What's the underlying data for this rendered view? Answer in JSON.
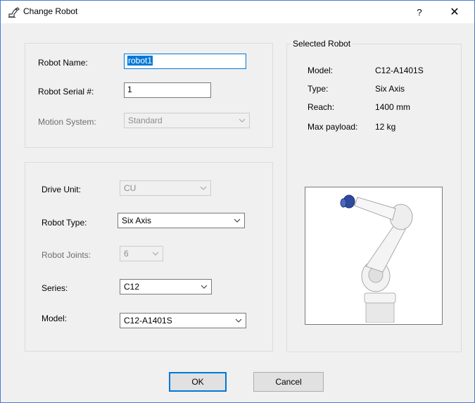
{
  "window": {
    "title": "Change Robot",
    "help_label": "?",
    "close_label": "✕"
  },
  "robot_group": {
    "name_label": "Robot Name:",
    "name_value": "robot1",
    "serial_label": "Robot Serial #:",
    "serial_value": "1",
    "motion_label": "Motion System:",
    "motion_value": "Standard"
  },
  "config_group": {
    "drive_label": "Drive Unit:",
    "drive_value": "CU",
    "type_label": "Robot Type:",
    "type_value": "Six Axis",
    "joints_label": "Robot Joints:",
    "joints_value": "6",
    "series_label": "Series:",
    "series_value": "C12",
    "model_label": "Model:",
    "model_value": "C12-A1401S"
  },
  "selected_robot": {
    "title": "Selected Robot",
    "rows": [
      {
        "key": "Model:",
        "value": "C12-A1401S"
      },
      {
        "key": "Type:",
        "value": "Six Axis"
      },
      {
        "key": "Reach:",
        "value": "1400 mm"
      },
      {
        "key": "Max payload:",
        "value": "12 kg"
      }
    ]
  },
  "footer": {
    "ok_label": "OK",
    "cancel_label": "Cancel"
  }
}
